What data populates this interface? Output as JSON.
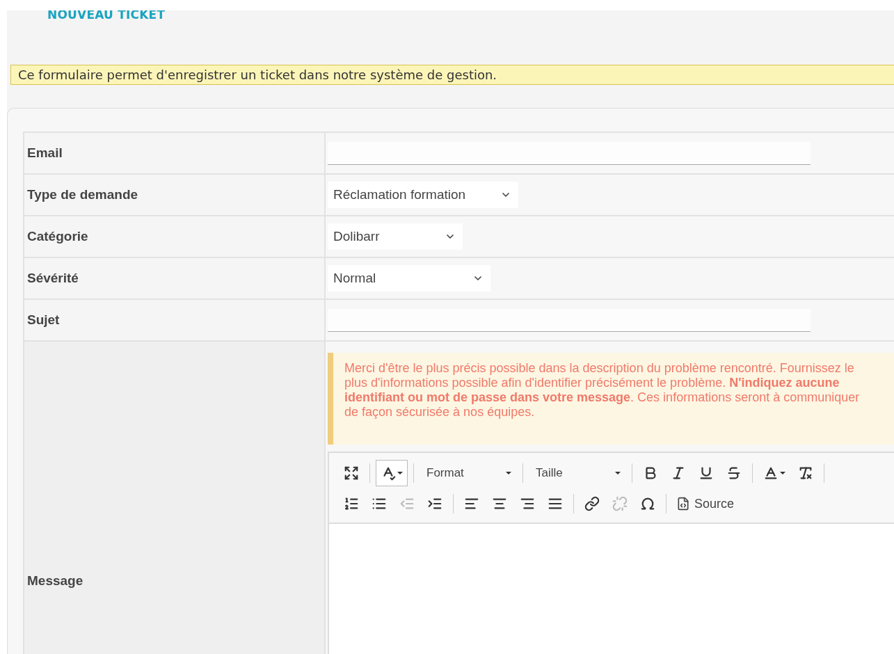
{
  "page_title": "NOUVEAU TICKET",
  "info_banner": "Ce formulaire permet d'enregistrer un ticket dans notre système de gestion.",
  "form": {
    "rows": [
      {
        "label": "Email",
        "kind": "input"
      },
      {
        "label": "Type de demande",
        "kind": "select",
        "value": "Réclamation formation"
      },
      {
        "label": "Catégorie",
        "kind": "select",
        "value": "Dolibarr"
      },
      {
        "label": "Sévérité",
        "kind": "select",
        "value": "Normal"
      },
      {
        "label": "Sujet",
        "kind": "input"
      },
      {
        "label": "Message",
        "kind": "editor"
      }
    ]
  },
  "message_notice": "Merci d'être le plus précis possible dans la description du problème rencontré. Fournissez le plus d'informations possible afin d'identifier précisément le problème. **N'indiquez aucune identifiant ou mot de passe dans votre message**. Ces informations seront à communiquer de façon sécurisée à nos équipes.",
  "editor_toolbar": {
    "rows": [
      [
        {
          "kind": "icon",
          "disabled": false,
          "pressed": false
        },
        {
          "kind": "separator"
        },
        {
          "kind": "icon-menu",
          "disabled": false,
          "pressed": true
        },
        {
          "kind": "separator"
        },
        {
          "kind": "dropdown",
          "label": "Format"
        },
        {
          "kind": "separator"
        },
        {
          "kind": "dropdown",
          "label": "Taille"
        },
        {
          "kind": "separator"
        },
        {
          "kind": "icon",
          "disabled": false,
          "pressed": false
        },
        {
          "kind": "icon",
          "disabled": false,
          "pressed": false
        },
        {
          "kind": "icon",
          "disabled": false,
          "pressed": false
        },
        {
          "kind": "icon",
          "disabled": false,
          "pressed": false
        },
        {
          "kind": "separator"
        },
        {
          "kind": "icon-menu",
          "disabled": false,
          "pressed": false
        },
        {
          "kind": "icon",
          "disabled": false,
          "pressed": false
        },
        {
          "kind": "separator"
        }
      ],
      [
        {
          "kind": "icon",
          "disabled": false,
          "pressed": false
        },
        {
          "kind": "icon",
          "disabled": false,
          "pressed": false
        },
        {
          "kind": "icon",
          "disabled": true,
          "pressed": false
        },
        {
          "kind": "icon",
          "disabled": false,
          "pressed": false
        },
        {
          "kind": "separator"
        },
        {
          "kind": "icon",
          "disabled": false,
          "pressed": false
        },
        {
          "kind": "icon",
          "disabled": false,
          "pressed": false
        },
        {
          "kind": "icon",
          "disabled": false,
          "pressed": false
        },
        {
          "kind": "icon",
          "disabled": false,
          "pressed": false
        },
        {
          "kind": "separator"
        },
        {
          "kind": "icon",
          "disabled": false,
          "pressed": false
        },
        {
          "kind": "icon",
          "disabled": true,
          "pressed": false
        },
        {
          "kind": "icon",
          "disabled": false,
          "pressed": false
        },
        {
          "kind": "separator"
        },
        {
          "kind": "text-button",
          "label": "Source"
        }
      ]
    ]
  }
}
